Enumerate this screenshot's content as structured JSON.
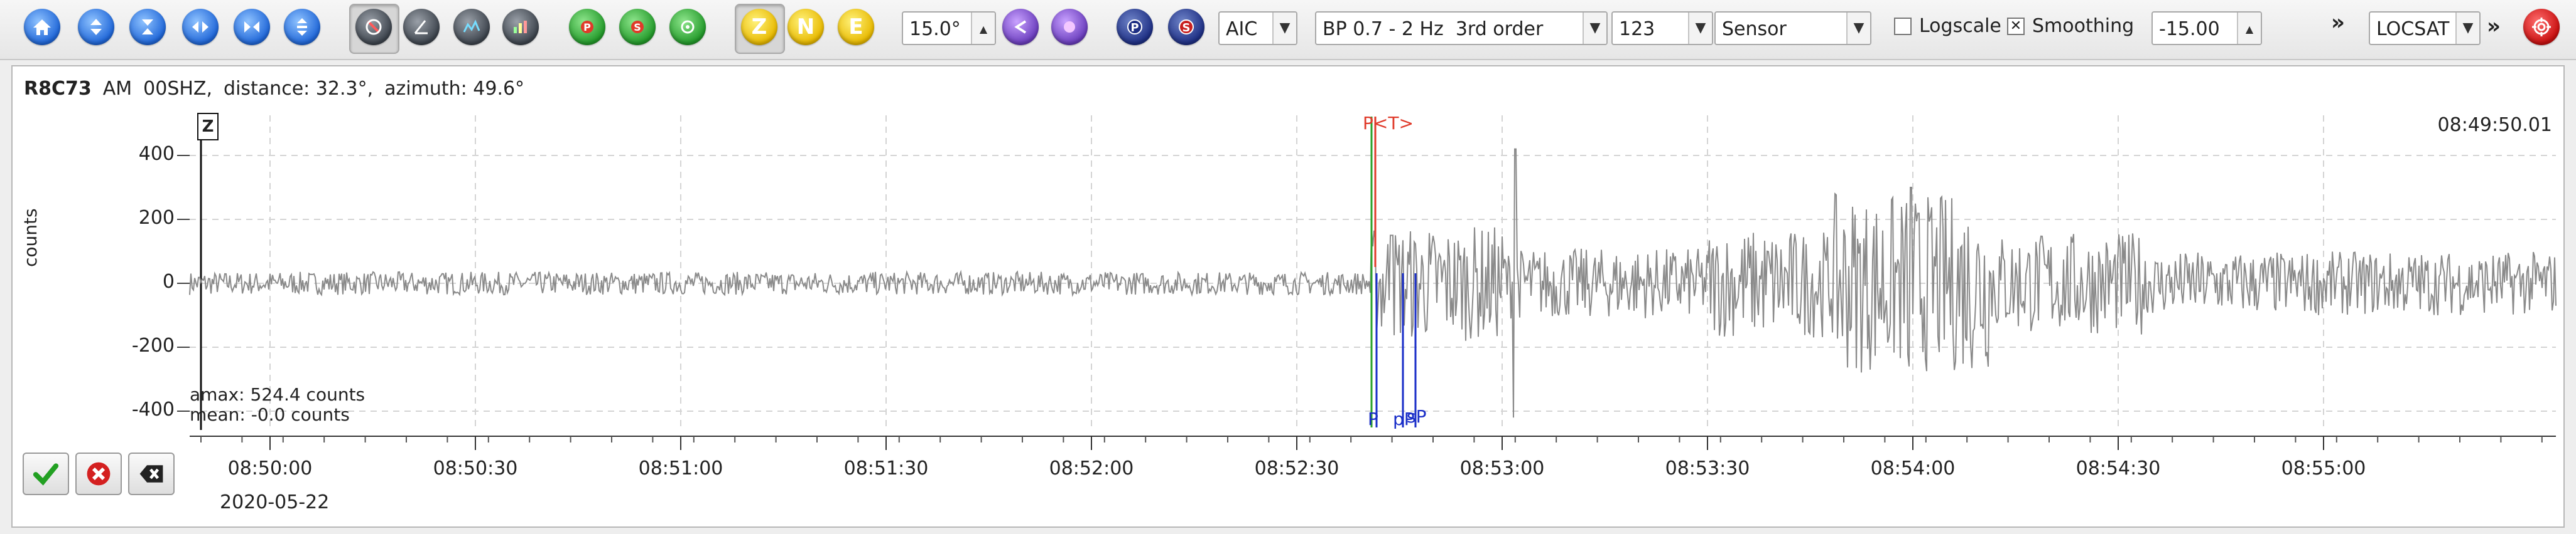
{
  "toolbar": {
    "spinner_value": "15.0°",
    "picker_method": "AIC",
    "filter": "BP 0.7 - 2 Hz  3rd order",
    "component_set": "123",
    "unit_mode": "Sensor",
    "logscale_label": "Logscale",
    "logscale_checked": false,
    "smoothing_label": "Smoothing",
    "smoothing_checked": true,
    "amplitude_value": "-15.00",
    "more_symbol": "»",
    "locator": "LOCSAT",
    "zne": [
      "Z",
      "N",
      "E"
    ],
    "phase_buttons": [
      "P",
      "S"
    ]
  },
  "trace": {
    "station": "R8C73",
    "network": "AM",
    "channel": "00SHZ,",
    "distance": "distance: 32.3°,",
    "azimuth": "azimuth: 49.6°",
    "component": "Z",
    "time_readout": "08:49:50.01",
    "ylabel": "counts",
    "yticks": [
      "400",
      "200",
      "0",
      "-200",
      "-400"
    ],
    "amax": "amax: 524.4 counts",
    "mean": "mean: -0.0 counts",
    "xticks": [
      "08:50:00",
      "08:50:30",
      "08:51:00",
      "08:51:30",
      "08:52:00",
      "08:52:30",
      "08:53:00",
      "08:53:30",
      "08:54:00",
      "08:54:30",
      "08:55:00"
    ],
    "date": "2020-05-22",
    "picks": {
      "top_p": "P",
      "top_t": "<T>",
      "bottom_p": "P",
      "pp": "pP",
      "sp": "sP"
    }
  },
  "colors": {
    "trace": "#8a8a8a",
    "pick_blue": "#1a2ec8",
    "pick_red": "#e03a2a",
    "pick_green": "#2aa02a",
    "grid": "#d4d4d4"
  }
}
